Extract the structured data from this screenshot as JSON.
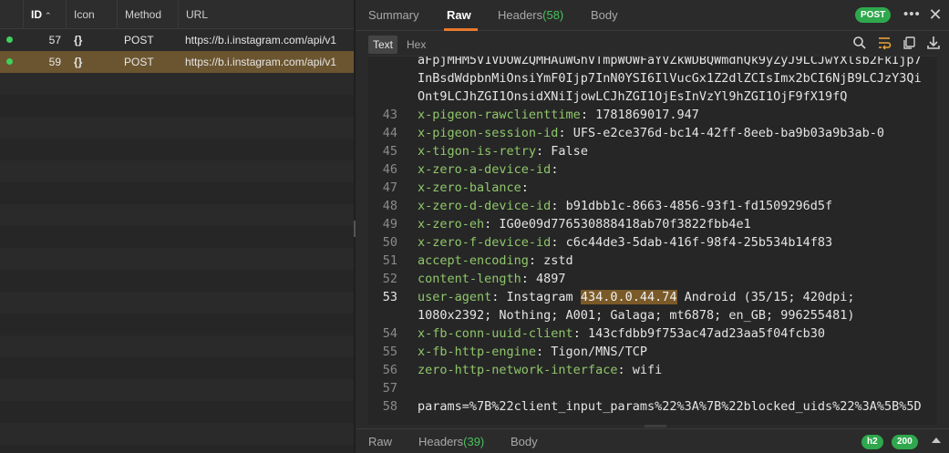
{
  "table": {
    "columns": {
      "id": "ID",
      "icon": "Icon",
      "method": "Method",
      "url": "URL"
    },
    "rows": [
      {
        "id": "57",
        "icon": "{}",
        "method": "POST",
        "url": "https://b.i.instagram.com/api/v1",
        "status_color": "#3ecf5c"
      },
      {
        "id": "59",
        "icon": "{}",
        "method": "POST",
        "url": "https://b.i.instagram.com/api/v1",
        "status_color": "#3ecf5c"
      }
    ]
  },
  "detail": {
    "tabs": {
      "summary": "Summary",
      "raw": "Raw",
      "headers": "Headers",
      "headers_count": "(58)",
      "body": "Body"
    },
    "method_badge": "POST",
    "subtabs": {
      "text": "Text",
      "hex": "Hex"
    },
    "lines": {
      "wrap1": "aFpjMHM5V1VDOWZQMHAuWGhVTmpWOWFaYVZkWDBQWmdhQk9yZyJ9LCJwYXlsb2FkIjp7",
      "wrap2": "InBsdWdpbnMiOnsiYmF0Ijp7InN0YSI6IlVucGx1Z2dlZCIsImx2bCI6NjB9LCJzY3Qi",
      "wrap3": "Ont9LCJhZGI1OnsidXNiIjowLCJhZGI1OjEsInVzYl9hZGI1OjF9fX19fQ",
      "l43": {
        "n": "43",
        "k": "x-pigeon-rawclienttime",
        "v": ": 1781869017.947"
      },
      "l44": {
        "n": "44",
        "k": "x-pigeon-session-id",
        "v": ": UFS-e2ce376d-bc14-42ff-8eeb-ba9b03a9b3ab-0"
      },
      "l45": {
        "n": "45",
        "k": "x-tigon-is-retry",
        "v": ": False"
      },
      "l46": {
        "n": "46",
        "k": "x-zero-a-device-id",
        "v": ":"
      },
      "l47": {
        "n": "47",
        "k": "x-zero-balance",
        "v": ":"
      },
      "l48": {
        "n": "48",
        "k": "x-zero-d-device-id",
        "v": ": b91dbb1c-8663-4856-93f1-fd1509296d5f"
      },
      "l49": {
        "n": "49",
        "k": "x-zero-eh",
        "v": ": IG0e09d776530888418ab70f3822fbb4e1"
      },
      "l50": {
        "n": "50",
        "k": "x-zero-f-device-id",
        "v": ": c6c44de3-5dab-416f-98f4-25b534b14f83"
      },
      "l51": {
        "n": "51",
        "k": "accept-encoding",
        "v": ": zstd"
      },
      "l52": {
        "n": "52",
        "k": "content-length",
        "v": ": 4897"
      },
      "l53": {
        "n": "53",
        "k": "user-agent",
        "v1": ": Instagram ",
        "hl": "434.0.0.44.74",
        "v2": " Android (35/15; 420dpi;",
        "wrap": "1080x2392; Nothing; A001; Galaga; mt6878; en_GB; 996255481)"
      },
      "l54": {
        "n": "54",
        "k": "x-fb-conn-uuid-client",
        "v": ": 143cfdbb9f753ac47ad23aa5f04fcb30"
      },
      "l55": {
        "n": "55",
        "k": "x-fb-http-engine",
        "v": ": Tigon/MNS/TCP"
      },
      "l56": {
        "n": "56",
        "k": "zero-http-network-interface",
        "v": ": wifi"
      },
      "l57": {
        "n": "57"
      },
      "l58": {
        "n": "58",
        "v": "params=%7B%22client_input_params%22%3A%7B%22blocked_uids%22%3A%5B%5D"
      }
    }
  },
  "bottom": {
    "raw": "Raw",
    "headers": "Headers",
    "headers_count": "(39)",
    "body": "Body",
    "protocol": "h2",
    "status": "200"
  },
  "colors": {
    "accent": "#e8792f",
    "success": "#2fa84d",
    "selection": "#6b5530",
    "header_key": "#8fc76a"
  }
}
